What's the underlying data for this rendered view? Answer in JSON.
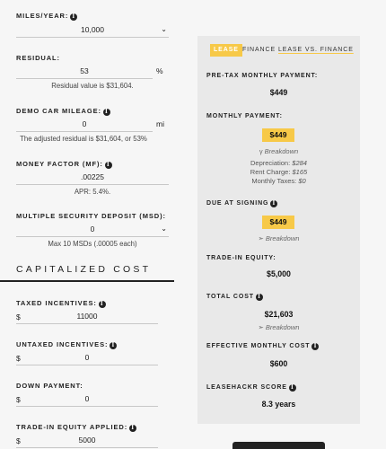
{
  "form": {
    "miles_per_year": {
      "label": "MILES/YEAR",
      "value": "10,000"
    },
    "residual": {
      "label": "RESIDUAL:",
      "value": "53",
      "unit": "%",
      "hint": "Residual value is $31,604."
    },
    "demo_mileage": {
      "label": "DEMO CAR MILEAGE",
      "value": "0",
      "unit": "mi",
      "hint": "The adjusted residual is $31,604, or 53%"
    },
    "money_factor": {
      "label": "MONEY FACTOR (MF)",
      "value": ".00225",
      "hint": "APR: 5.4%."
    },
    "msd": {
      "label": "MULTIPLE SECURITY DEPOSIT (MSD):",
      "value": "0",
      "hint": "Max 10 MSDs (.00005 each)"
    },
    "section_title": "CAPITALIZED COST",
    "taxed_incentives": {
      "label": "TAXED INCENTIVES",
      "currency": "$",
      "value": "11000"
    },
    "untaxed_incentives": {
      "label": "UNTAXED INCENTIVES",
      "currency": "$",
      "value": "0"
    },
    "down_payment": {
      "label": "DOWN PAYMENT:",
      "currency": "$",
      "value": "0"
    },
    "trade_in_applied": {
      "label": "TRADE-IN EQUITY APPLIED",
      "currency": "$",
      "value": "5000"
    }
  },
  "panel": {
    "tabs": [
      {
        "label": "LEASE",
        "active": true
      },
      {
        "label": "FINANCE",
        "active": false
      },
      {
        "label": "LEASE VS. FINANCE",
        "active": false
      }
    ],
    "pretax_monthly": {
      "label": "PRE-TAX MONTHLY PAYMENT:",
      "value": "$449"
    },
    "monthly": {
      "label": "MONTHLY PAYMENT:",
      "value": "$449",
      "breakdown_toggle": "Breakdown",
      "toggle_arrow": "γ",
      "depreciation_label": "Depreciation:",
      "depreciation": "$284",
      "rent_label": "Rent Charge:",
      "rent": "$165",
      "taxes_label": "Monthly Taxes:",
      "taxes": "$0"
    },
    "due_at_signing": {
      "label": "DUE AT SIGNING",
      "value": "$449",
      "breakdown_toggle": "Breakdown",
      "toggle_arrow": "➣"
    },
    "trade_in_equity": {
      "label": "TRADE-IN EQUITY:",
      "value": "$5,000"
    },
    "total_cost": {
      "label": "TOTAL COST",
      "value": "$21,603",
      "breakdown_toggle": "Breakdown",
      "toggle_arrow": "➣"
    },
    "effective_monthly": {
      "label": "EFFECTIVE MONTHLY COST",
      "value": "$600"
    },
    "leasehackr_score": {
      "label": "LEASEHACKR SCORE",
      "value": "8.3 years"
    }
  },
  "icons": {
    "info": "info-icon",
    "dropdown": "chevron-down-icon"
  },
  "colors": {
    "accent": "#f7c948",
    "panel_bg": "#e9e9e9",
    "page_bg": "#f6f6f6"
  }
}
